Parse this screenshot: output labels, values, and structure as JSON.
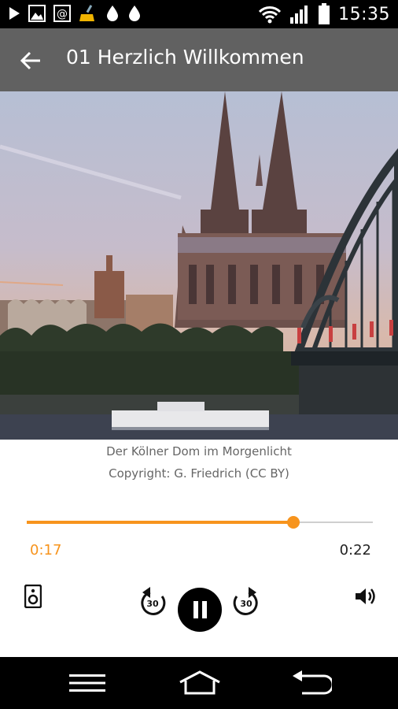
{
  "status_bar": {
    "time": "15:35",
    "left_icons": [
      "play-icon",
      "image-icon",
      "at-icon",
      "broom-icon",
      "drop-icon",
      "drop-icon"
    ],
    "right_icons": [
      "wifi-icon",
      "signal-icon",
      "battery-icon"
    ]
  },
  "app_bar": {
    "title": "01 Herzlich Willkommen",
    "back_icon": "arrow-left-icon",
    "background": "#616161"
  },
  "photo": {
    "caption": "Der Kölner Dom im Morgenlicht",
    "copyright": "Copyright: G. Friedrich (CC BY)"
  },
  "player": {
    "progress_fraction": 0.77,
    "elapsed": "0:17",
    "total": "0:22",
    "accent": "#f7941d",
    "controls": {
      "speaker_icon": "speaker-device-icon",
      "rewind_label": "30",
      "forward_label": "30",
      "play_pause_icon": "pause-icon",
      "volume_icon": "volume-icon"
    }
  },
  "nav_bar": {
    "icons": [
      "menu-icon",
      "home-icon",
      "back-icon"
    ]
  }
}
